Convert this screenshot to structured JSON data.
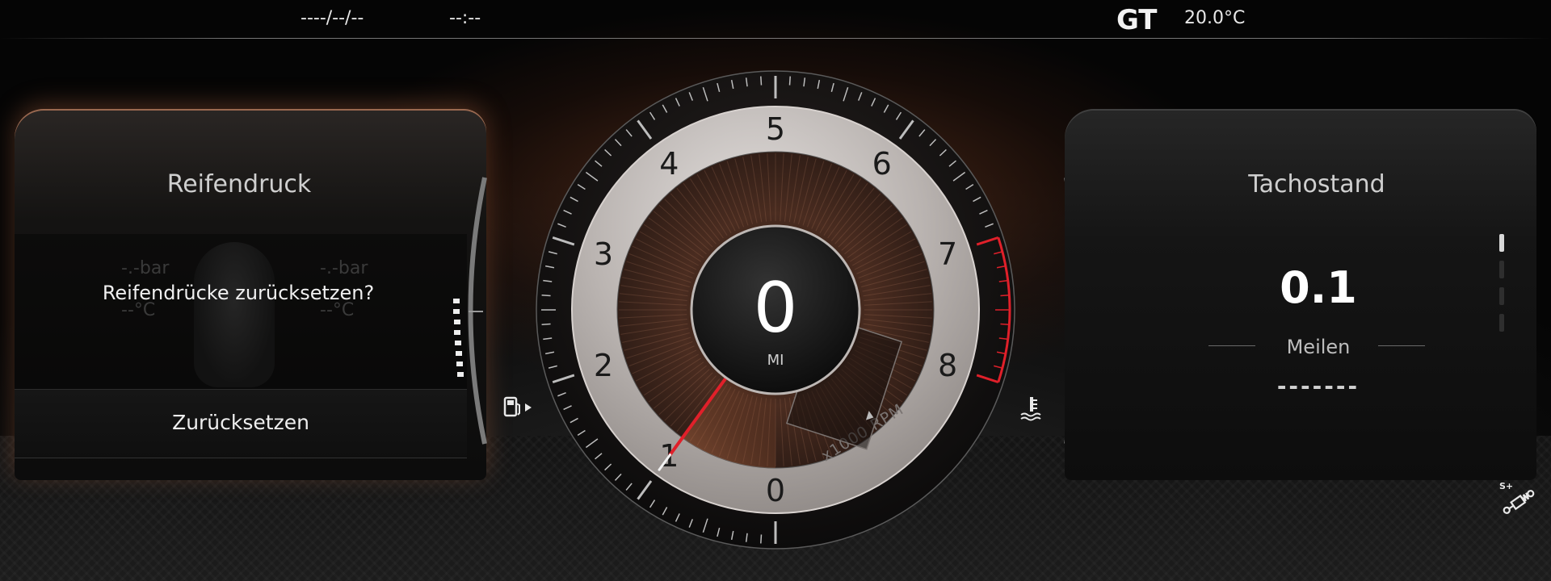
{
  "topbar": {
    "date": "----/--/--",
    "time": "--:--",
    "drive_mode": "GT",
    "outside_temp": "20.0°C"
  },
  "left_panel": {
    "title": "Reifendruck",
    "tire_pressure_placeholder": "-.-bar",
    "tire_temp_placeholder": "--°C",
    "dialog_text": "Reifendrücke zurücksetzen?",
    "reset_button_label": "Zurücksetzen"
  },
  "gauge": {
    "tick_labels": [
      "0",
      "1",
      "2",
      "3",
      "4",
      "5",
      "6",
      "7",
      "8"
    ],
    "rpm_unit": "x1000 RPM",
    "rpm_value_thousands": 1.0,
    "redline_from_thousands": 7,
    "speed_value": "0",
    "speed_unit": "MI"
  },
  "right_panel": {
    "title": "Tachostand",
    "odometer_value": "0.1",
    "odometer_unit": "Meilen",
    "odometer_secondary": "-------"
  },
  "icons": {
    "fuel": "fuel-pump-icon",
    "coolant": "coolant-temperature-icon",
    "suspension": "suspension-sport-plus-icon",
    "suspension_badge": "S+"
  },
  "colors": {
    "accent_orange": "#c8703c",
    "redline": "#e0202a",
    "cold_blue": "#2d6bd8"
  },
  "pagination": {
    "count": 4,
    "active": 1
  }
}
